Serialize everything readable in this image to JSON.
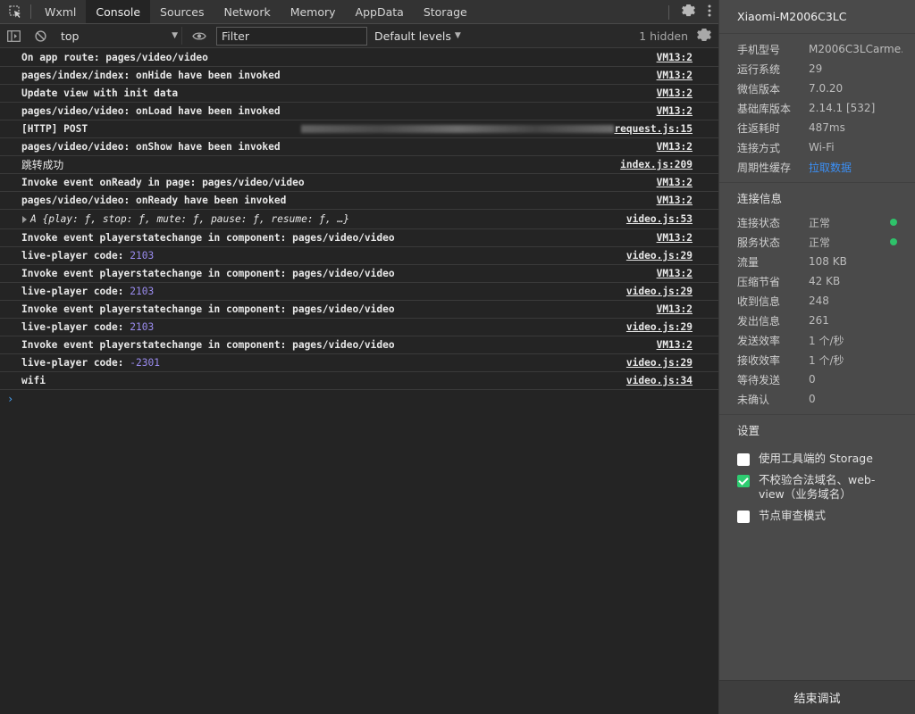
{
  "tabs": [
    "Wxml",
    "Console",
    "Sources",
    "Network",
    "Memory",
    "AppData",
    "Storage"
  ],
  "active_tab": "Console",
  "toolbar": {
    "context": "top",
    "filter_placeholder": "Filter",
    "levels": "Default levels",
    "hidden": "1 hidden"
  },
  "logs": [
    {
      "msg": "On app route: pages/video/video",
      "src": "VM13:2"
    },
    {
      "msg": "pages/index/index: onHide have been invoked",
      "src": "VM13:2"
    },
    {
      "msg": "Update view with init data",
      "src": "VM13:2"
    },
    {
      "msg": "pages/video/video: onLoad have been invoked",
      "src": "VM13:2"
    },
    {
      "msg": "[HTTP] POST",
      "src": "request.js:15"
    },
    {
      "msg": "pages/video/video: onShow have been invoked",
      "src": "VM13:2"
    },
    {
      "msg": "跳转成功",
      "src": "index.js:209"
    },
    {
      "msg": "Invoke event onReady in page: pages/video/video",
      "src": "VM13:2"
    },
    {
      "msg": "pages/video/video: onReady have been invoked",
      "src": "VM13:2"
    },
    {
      "msg": "A {play: ƒ, stop: ƒ, mute: ƒ, pause: ƒ, resume: ƒ, …}",
      "src": "video.js:53"
    },
    {
      "msg": "Invoke event playerstatechange in component: pages/video/video",
      "src": "VM13:2"
    },
    {
      "prefix": "live-player code: ",
      "num": "2103",
      "src": "video.js:29"
    },
    {
      "msg": "Invoke event playerstatechange in component: pages/video/video",
      "src": "VM13:2"
    },
    {
      "prefix": "live-player code: ",
      "num": "2103",
      "src": "video.js:29"
    },
    {
      "msg": "Invoke event playerstatechange in component: pages/video/video",
      "src": "VM13:2"
    },
    {
      "prefix": "live-player code: ",
      "num": "2103",
      "src": "video.js:29"
    },
    {
      "msg": "Invoke event playerstatechange in component: pages/video/video",
      "src": "VM13:2"
    },
    {
      "prefix": "live-player code: ",
      "num": "-2301",
      "src": "video.js:29"
    },
    {
      "msg": "wifi",
      "src": "video.js:34"
    }
  ],
  "panel": {
    "device": "Xiaomi-M2006C3LC",
    "device_info": [
      {
        "k": "手机型号",
        "v": "M2006C3LCarme..."
      },
      {
        "k": "运行系统",
        "v": "29"
      },
      {
        "k": "微信版本",
        "v": "7.0.20"
      },
      {
        "k": "基础库版本",
        "v": "2.14.1 [532]"
      },
      {
        "k": "往返耗时",
        "v": "487ms"
      },
      {
        "k": "连接方式",
        "v": "Wi-Fi"
      },
      {
        "k": "周期性缓存",
        "v": "拉取数据"
      }
    ],
    "conn_title": "连接信息",
    "conn_info": [
      {
        "k": "连接状态",
        "v": "正常"
      },
      {
        "k": "服务状态",
        "v": "正常"
      },
      {
        "k": "流量",
        "v": "108 KB"
      },
      {
        "k": "压缩节省",
        "v": "42 KB"
      },
      {
        "k": "收到信息",
        "v": "248"
      },
      {
        "k": "发出信息",
        "v": "261"
      },
      {
        "k": "发送效率",
        "v": "1 个/秒"
      },
      {
        "k": "接收效率",
        "v": "1 个/秒"
      },
      {
        "k": "等待发送",
        "v": "0"
      },
      {
        "k": "未确认",
        "v": "0"
      }
    ],
    "settings_title": "设置",
    "settings": [
      {
        "label": "使用工具端的 Storage",
        "checked": false
      },
      {
        "label": "不校验合法域名、web-view（业务域名）",
        "checked": true
      },
      {
        "label": "节点审查模式",
        "checked": false
      }
    ],
    "end_button": "结束调试"
  },
  "colors": {
    "link": "#3b8ff5",
    "status_ok": "#2fc26a",
    "number": "#9b8cf0",
    "prompt": "#4aa3f5"
  }
}
